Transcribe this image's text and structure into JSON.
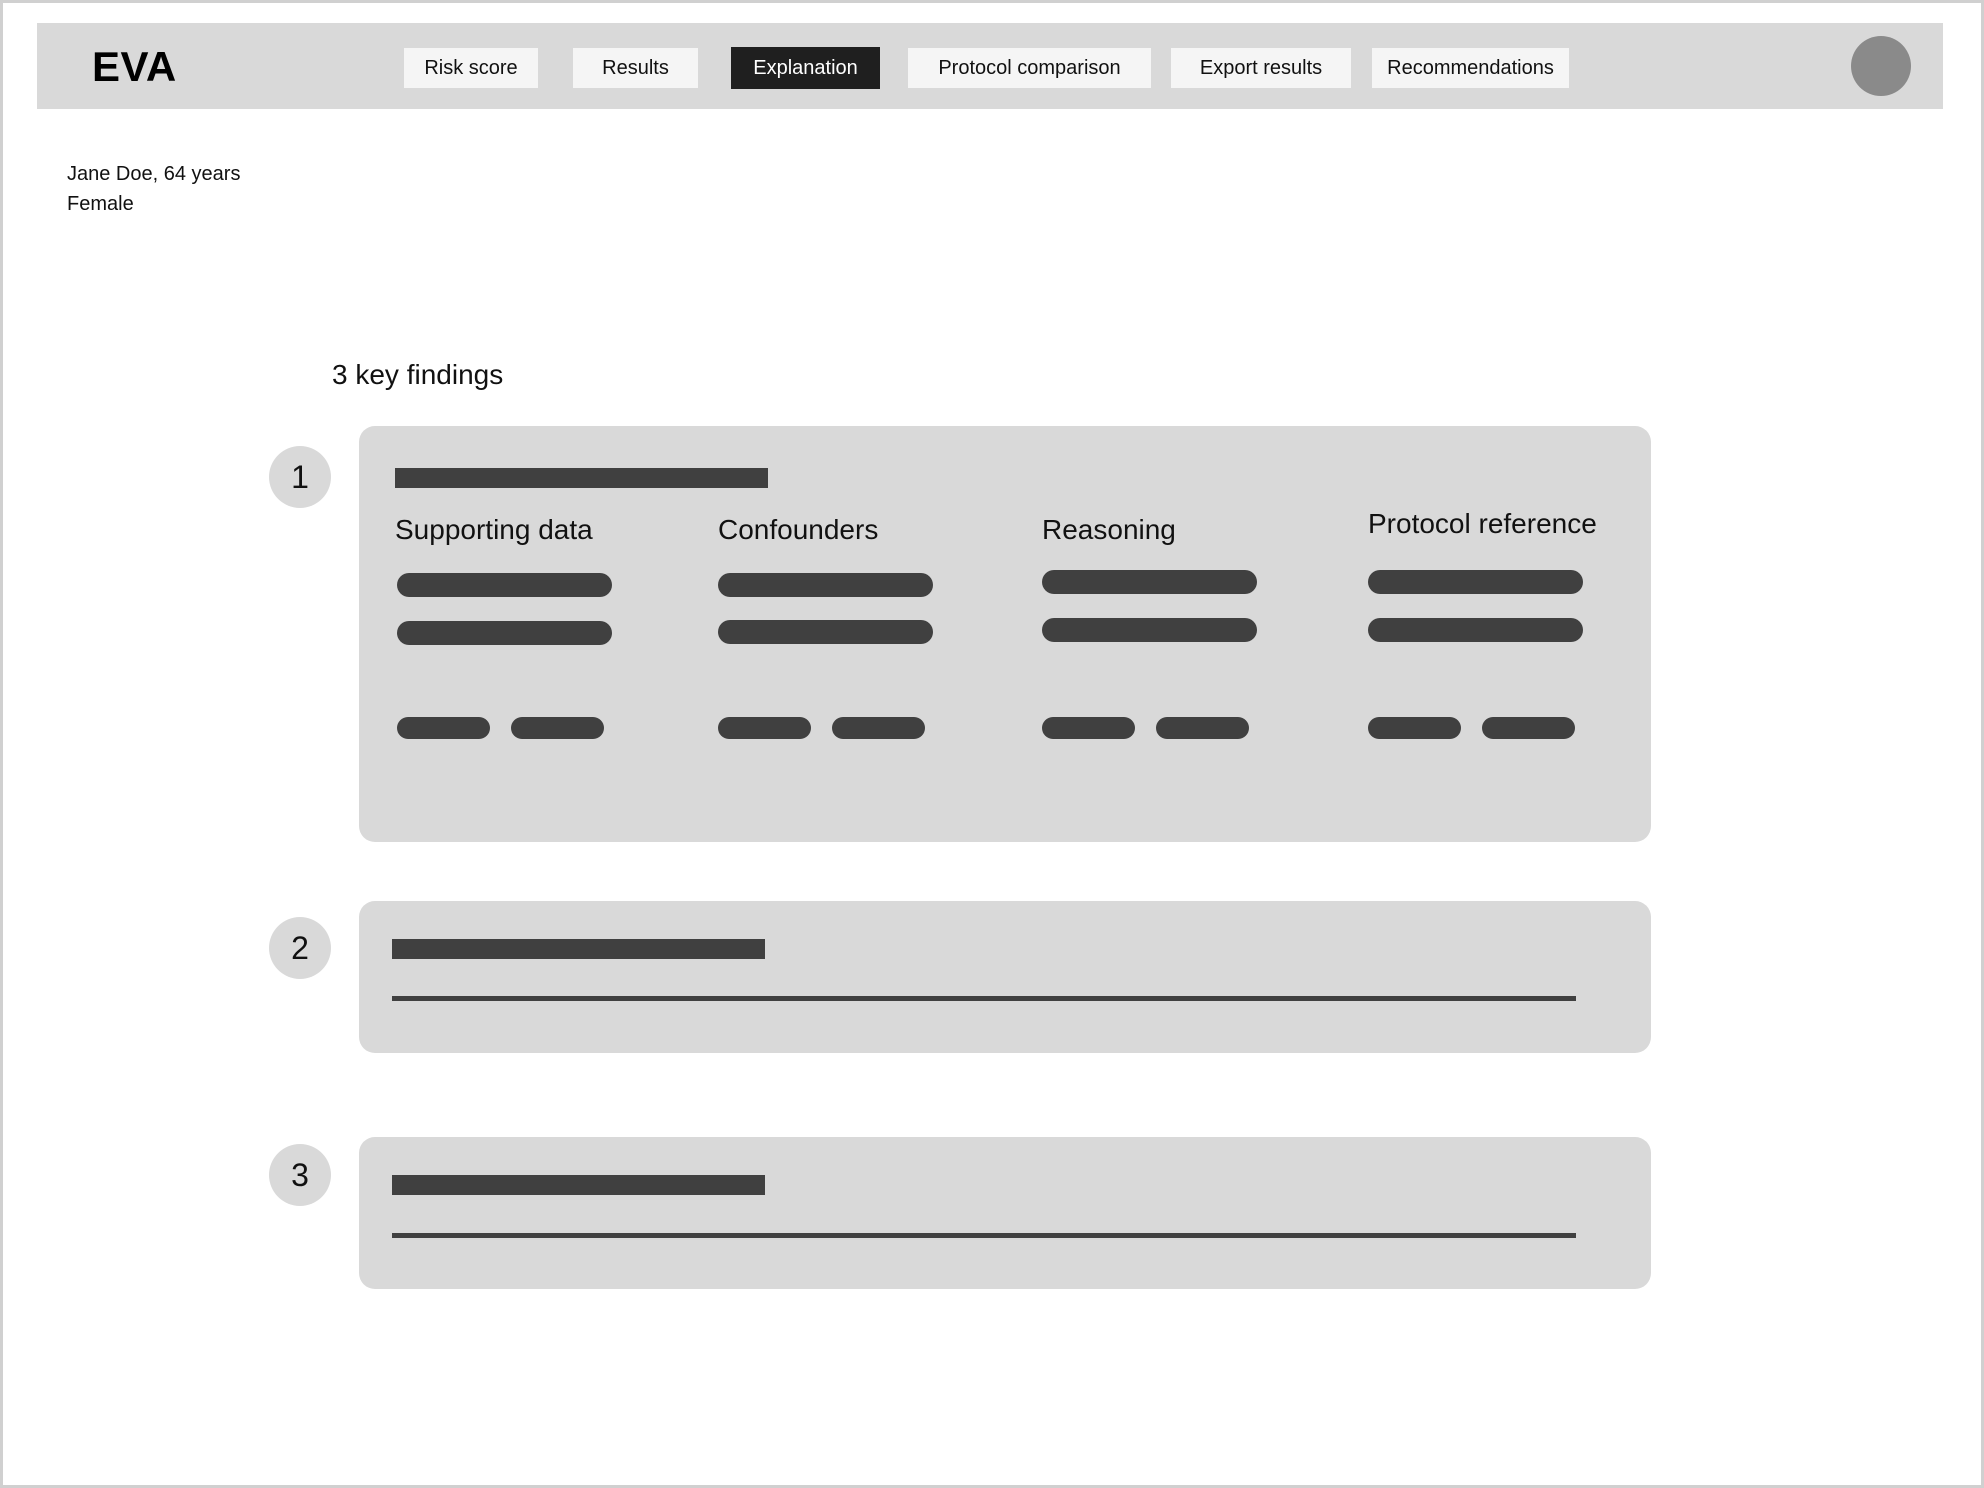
{
  "app": {
    "title": "EVA"
  },
  "nav": {
    "tabs": [
      {
        "label": "Risk score",
        "active": false
      },
      {
        "label": "Results",
        "active": false
      },
      {
        "label": "Explanation",
        "active": true
      },
      {
        "label": "Protocol comparison",
        "active": false
      },
      {
        "label": "Export results",
        "active": false
      },
      {
        "label": "Recommendations",
        "active": false
      }
    ]
  },
  "patient": {
    "line1": "Jane Doe, 64 years",
    "line2": "Female"
  },
  "findings": {
    "title": "3 key findings",
    "items": [
      {
        "number": "1",
        "expanded": true,
        "columns": [
          "Supporting data",
          "Confounders",
          "Reasoning",
          "Protocol reference"
        ]
      },
      {
        "number": "2",
        "expanded": false
      },
      {
        "number": "3",
        "expanded": false
      }
    ]
  },
  "colors": {
    "header_bg": "#d9d9d9",
    "active_tab_bg": "#1f1f1f",
    "placeholder": "#404040",
    "card_bg": "#d9d9d9",
    "avatar": "#8a8a8a"
  },
  "icons": {
    "avatar": "user-avatar-icon"
  }
}
